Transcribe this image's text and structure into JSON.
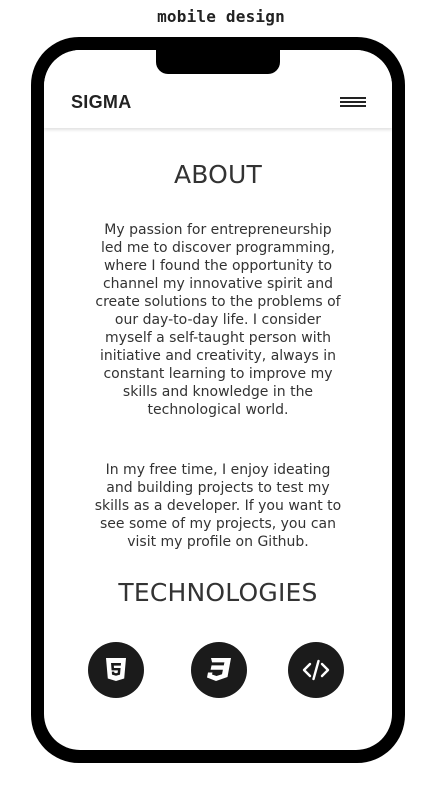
{
  "caption": "mobile design",
  "navbar": {
    "logo": "SIGMA",
    "menu_icon": "hamburger-menu-icon"
  },
  "about": {
    "title": "ABOUT",
    "paragraph_1": "My passion for entrepreneurship led me to discover programming, where I found the opportunity to channel my innovative spirit and create solutions to the problems of our day-to-day life. I consider myself a self-taught person with initiative and creativity, always in constant learning to improve my skills and knowledge in the technological world.",
    "paragraph_2": "In my free time, I enjoy ideating and building projects to test my skills as a developer. If you want to see some of my projects, you can visit my profile on Github."
  },
  "technologies": {
    "title": "TECHNOLOGIES",
    "items": [
      {
        "icon": "html5-icon"
      },
      {
        "icon": "css3-icon"
      },
      {
        "icon": "code-icon"
      }
    ]
  },
  "colors": {
    "phone_frame": "#000000",
    "text": "#333333",
    "icon_bg": "#1b1b1b"
  }
}
